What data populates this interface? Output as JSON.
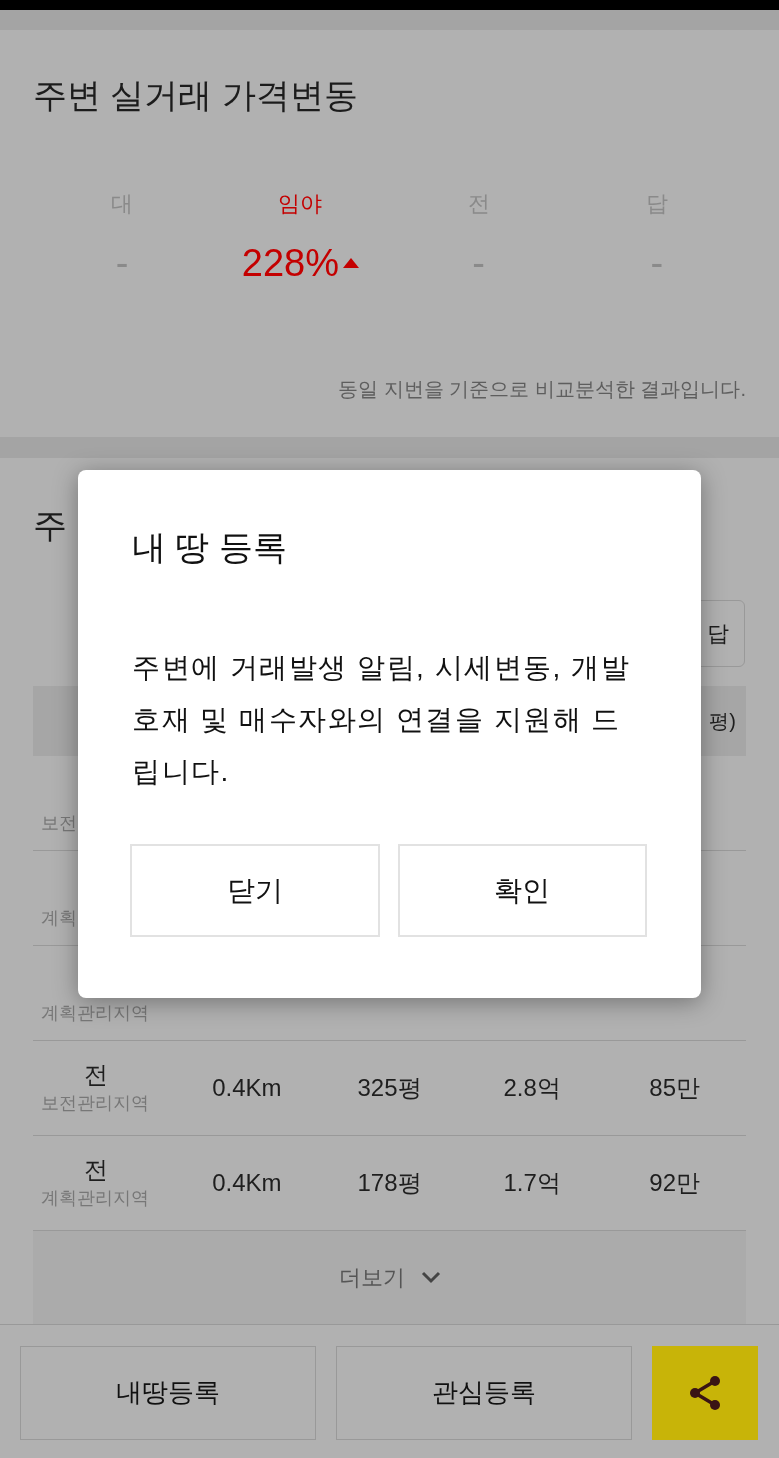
{
  "price_change": {
    "title": "주변 실거래 가격변동",
    "columns": [
      {
        "label": "대",
        "value": "-",
        "highlighted": false
      },
      {
        "label": "임야",
        "value": "228%",
        "highlighted": true
      },
      {
        "label": "전",
        "value": "-",
        "highlighted": false
      },
      {
        "label": "답",
        "value": "-",
        "highlighted": false
      }
    ],
    "note": "동일 지번을 기준으로 비교분석한 결과입니다."
  },
  "nearby": {
    "title": "주",
    "filter_button": "답",
    "header_last": "평)",
    "rows": [
      {
        "zone": "보전"
      },
      {
        "zone": "계획"
      },
      {
        "zone": "계획관리지역"
      },
      {
        "land_type": "전",
        "zone": "보전관리지역",
        "distance": "0.4Km",
        "area": "325평",
        "price": "2.8억",
        "unit_price": "85만"
      },
      {
        "land_type": "전",
        "zone": "계획관리지역",
        "distance": "0.4Km",
        "area": "178평",
        "price": "1.7억",
        "unit_price": "92만"
      }
    ],
    "more": "더보기"
  },
  "bottom_bar": {
    "buttons": [
      "내땅등록",
      "관심등록"
    ]
  },
  "dialog": {
    "title": "내 땅 등록",
    "message": "주변에 거래발생 알림, 시세변동, 개발 호재 및 매수자와의 연결을 지원해 드립니다.",
    "buttons": [
      "닫기",
      "확인"
    ]
  }
}
